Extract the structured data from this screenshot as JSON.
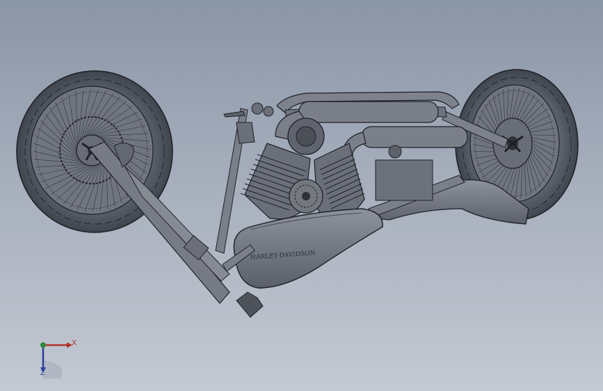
{
  "viewport": {
    "background_top": "#8a95a6",
    "background_bottom": "#c4c9d2",
    "model_fill": "#6f7480",
    "model_line": "#1d2026"
  },
  "model": {
    "tank_logo_text": "HARLEY-DAVIDSON"
  },
  "triad": {
    "x_label": "X",
    "z_label": "Z",
    "x_color": "#b0322a",
    "y_color": "#2e8a3a",
    "z_color": "#2c3f9c"
  }
}
